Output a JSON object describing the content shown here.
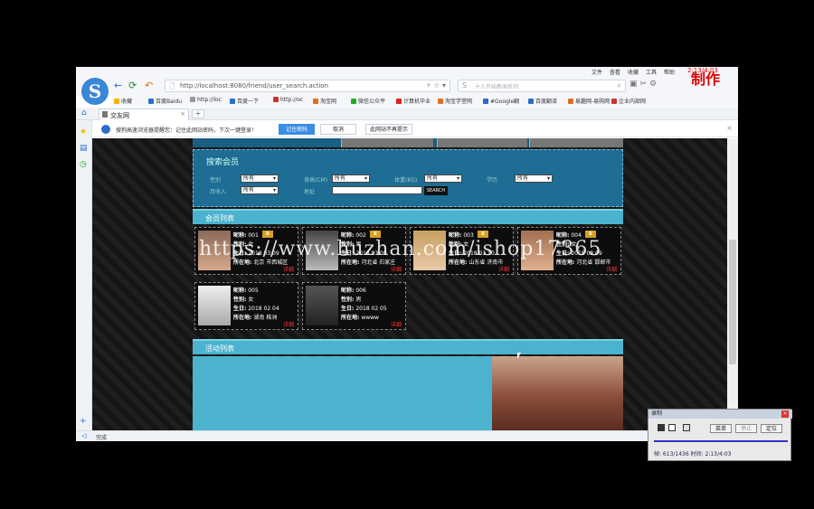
{
  "browser": {
    "menu_items": [
      "文件",
      "查看",
      "收藏",
      "工具",
      "帮助"
    ],
    "record_time": "2:13/4:03",
    "made_label": "制作",
    "address": "http://localhost:8080/friend/user_search.action",
    "search_placeholder": "十人开始新闻系列",
    "bookmarks": [
      "收藏",
      "百度Baidu",
      "http://loc",
      "百度一下",
      "http://oc",
      "淘宝网",
      "微信公众平",
      "计算机毕业",
      "淘宝学堂网",
      "#Google翻",
      "百度翻译",
      "易趣网-易购网",
      "企业内部网"
    ],
    "tab_label": "交友网",
    "notify_text": "搜狗高速浏览器提醒您：记住此网站密码，下次一键登录！",
    "notify_buttons": {
      "save": "记住密码",
      "cancel": "取消",
      "never": "此网站不再提示"
    },
    "status_text": "完成"
  },
  "page": {
    "search_title": "搜索会员",
    "fields": {
      "gender": {
        "label": "性别",
        "value": "所有"
      },
      "height": {
        "label": "身高(CM)",
        "value": "所有"
      },
      "weight": {
        "label": "体重(KG)",
        "value": "所有"
      },
      "education": {
        "label": "学历",
        "value": "所有"
      },
      "income": {
        "label": "月收入",
        "value": "所有"
      },
      "address": {
        "label": "地址"
      }
    },
    "search_button": "SEARCH",
    "members_title": "会员列表",
    "activity_title": "活动列表",
    "members": [
      {
        "nick_label": "昵称:",
        "nick": "001",
        "gender_label": "性别:",
        "gender": "女",
        "birth_label": "生日:",
        "birth": "2018 03 09",
        "loc_label": "所在地:",
        "loc": "北京 市西城区",
        "detail": "详细"
      },
      {
        "nick_label": "昵称:",
        "nick": "002",
        "gender_label": "性别:",
        "gender": "男",
        "birth_label": "生日:",
        "birth": "2018 03 09",
        "loc_label": "所在地:",
        "loc": "河北省 石家庄",
        "detail": "详细"
      },
      {
        "nick_label": "昵称:",
        "nick": "003",
        "gender_label": "性别:",
        "gender": "女",
        "birth_label": "生日:",
        "birth": "2018 03 10",
        "loc_label": "所在地:",
        "loc": "山东省 济南市",
        "detail": "详细"
      },
      {
        "nick_label": "昵称:",
        "nick": "004",
        "gender_label": "性别:",
        "gender": "女",
        "birth_label": "生日:",
        "birth": "2018 03 09",
        "loc_label": "所在地:",
        "loc": "河北省 邯郸市",
        "detail": "详细"
      },
      {
        "nick_label": "昵称:",
        "nick": "005",
        "gender_label": "性别:",
        "gender": "女",
        "birth_label": "生日:",
        "birth": "2018 02 04",
        "loc_label": "所在地:",
        "loc": "湖南 株洲",
        "detail": "详细"
      },
      {
        "nick_label": "昵称:",
        "nick": "006",
        "gender_label": "性别:",
        "gender": "男",
        "birth_label": "生日:",
        "birth": "2018 02 05",
        "loc_label": "所在地:",
        "loc": "wwww",
        "detail": "详细"
      }
    ],
    "watermark": "https://www.huzhan.com/ishop17365"
  },
  "recorder": {
    "title": "录制",
    "buttons": [
      "菜单",
      "停止",
      "定位"
    ],
    "info": "帧: 613/1436  时间: 2:13/4:03"
  }
}
